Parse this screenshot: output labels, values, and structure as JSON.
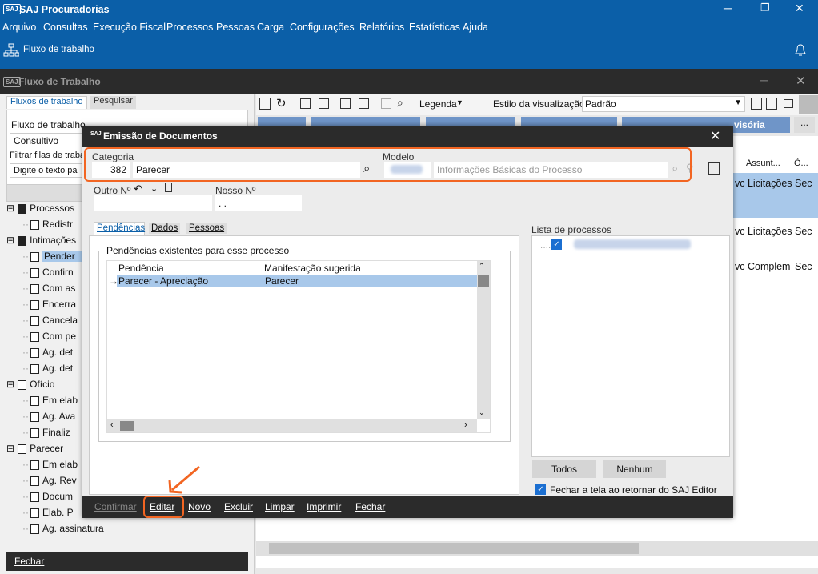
{
  "app": {
    "logo": "SAJ",
    "title": "SAJ Procuradorias",
    "controls": {
      "minimize": "─",
      "restore": "❐",
      "close": "✕"
    }
  },
  "menu": [
    "Arquivo",
    "Consultas",
    "Execução Fiscal",
    "Processos",
    "Pessoas",
    "Carga",
    "Configurações",
    "Relatórios",
    "Estatísticas",
    "Ajuda"
  ],
  "toolbar": {
    "workflow_label": "Fluxo de trabalho"
  },
  "inner_window": {
    "logo": "SAJ",
    "title": "Fluxo de Trabalho"
  },
  "left": {
    "tabs": [
      "Fluxos de trabalho",
      "Pesquisar"
    ],
    "fluxo_label": "Fluxo de trabalho",
    "fluxo_value": "Consultivo",
    "filtrar_label": "Filtrar filas de trabalho",
    "filtrar_placeholder": "Digite o texto pa",
    "tree": [
      {
        "label": "Processos",
        "level": 0,
        "icon": "list-icon"
      },
      {
        "label": "Redistr",
        "level": 1,
        "icon": "user-icon"
      },
      {
        "label": "Intimações",
        "level": 0,
        "icon": "list-icon"
      },
      {
        "label": "Pender",
        "level": 1,
        "icon": "doc-icon",
        "selected": true
      },
      {
        "label": "Confirn",
        "level": 1,
        "icon": "confirm-icon"
      },
      {
        "label": "Com as",
        "level": 1,
        "icon": "grid-icon"
      },
      {
        "label": "Encerra",
        "level": 1,
        "icon": "grid-icon"
      },
      {
        "label": "Cancela",
        "level": 1,
        "icon": "grid-icon"
      },
      {
        "label": "Com pe",
        "level": 1,
        "icon": "check-doc-icon"
      },
      {
        "label": "Ag. det",
        "level": 1,
        "icon": "grid-icon"
      },
      {
        "label": "Ag. det",
        "level": 1,
        "icon": "grid-icon"
      },
      {
        "label": "Ofício",
        "level": 0,
        "icon": "docs-icon"
      },
      {
        "label": "Em elab",
        "level": 1,
        "icon": "doc-icon"
      },
      {
        "label": "Ag. Ava",
        "level": 1,
        "icon": "doc-icon"
      },
      {
        "label": "Finaliz",
        "level": 1,
        "icon": "grid-icon"
      },
      {
        "label": "Parecer",
        "level": 0,
        "icon": "docs-icon"
      },
      {
        "label": "Em elab",
        "level": 1,
        "icon": "doc-icon"
      },
      {
        "label": "Ag. Rev",
        "level": 1,
        "icon": "doc-icon"
      },
      {
        "label": "Docum",
        "level": 1,
        "icon": "doc-icon"
      },
      {
        "label": "Elab. P",
        "level": 1,
        "icon": "doc-icon"
      },
      {
        "label": "Ag. assinatura",
        "level": 1,
        "icon": "sign-icon"
      }
    ],
    "fechar": "Fechar"
  },
  "right": {
    "legenda": "Legenda",
    "estilo_label": "Estilo da visualização",
    "estilo_value": "Padrão",
    "tab_partial": "visória",
    "more": "...",
    "col_assunto": "Assunt...",
    "col_o": "Ó...",
    "rows": [
      {
        "text": "vc Licitações",
        "extra": "Sec"
      },
      {
        "text": "vc Licitações",
        "extra": "Sec"
      },
      {
        "text": "vc Complem",
        "extra": "Sec"
      }
    ]
  },
  "dialog": {
    "logo": "SAJ",
    "title": "Emissão de Documentos",
    "categoria_label": "Categoria",
    "categoria_code": "382",
    "categoria_value": "Parecer",
    "modelo_label": "Modelo",
    "modelo_value": "Informações Básicas do Processo",
    "outro_label": "Outro Nº",
    "nosso_label": "Nosso Nº",
    "nosso_value": ". .",
    "tabs": [
      "Pendências",
      "Dados",
      "Pessoas"
    ],
    "group_title": "Pendências existentes para esse processo",
    "col_pendencia": "Pendência",
    "col_manifestacao": "Manifestação sugerida",
    "rows": [
      {
        "pendencia": "Parecer - Apreciação",
        "manifestacao": "Parecer"
      }
    ],
    "lista_label": "Lista de processos",
    "todos": "Todos",
    "nenhum": "Nenhum",
    "fechar_check": "Fechar a tela ao retornar do SAJ Editor",
    "buttons": [
      "Confirmar",
      "Editar",
      "Novo",
      "Excluir",
      "Limpar",
      "Imprimir",
      "Fechar"
    ]
  },
  "colors": {
    "brand_blue": "#0b5fa8",
    "highlight": "#f26522",
    "selection": "#a8c8ea"
  }
}
